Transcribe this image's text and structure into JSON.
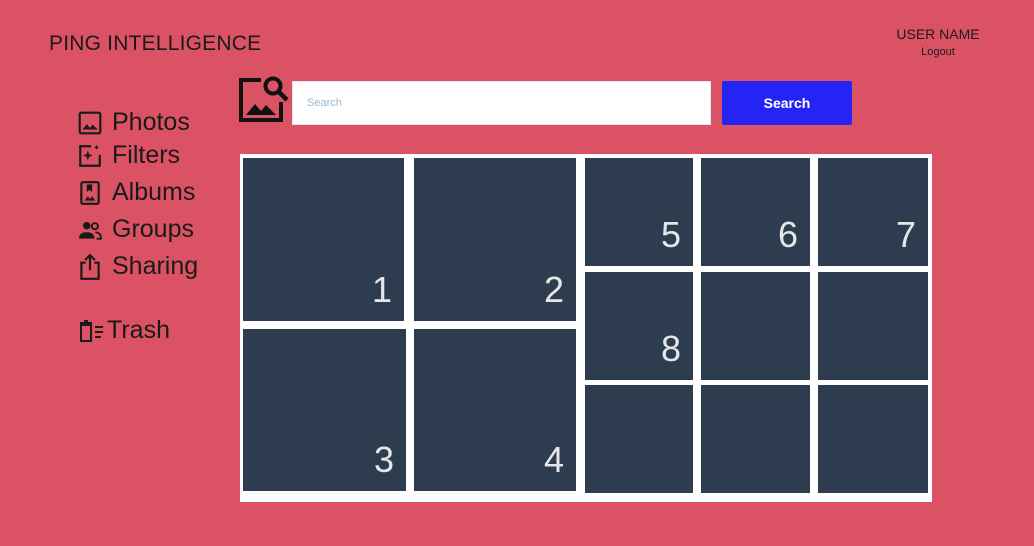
{
  "header": {
    "app_title": "PING INTELLIGENCE"
  },
  "user": {
    "name": "USER NAME",
    "logout_label": "Logout"
  },
  "sidebar": {
    "items": [
      {
        "label": "Photos",
        "icon": "image-icon"
      },
      {
        "label": "Filters",
        "icon": "filter-sparkle-icon"
      },
      {
        "label": "Albums",
        "icon": "album-icon"
      },
      {
        "label": "Groups",
        "icon": "groups-icon"
      },
      {
        "label": "Sharing",
        "icon": "share-icon"
      },
      {
        "label": "Trash",
        "icon": "trash-icon"
      }
    ]
  },
  "search": {
    "placeholder": "Search",
    "value": "",
    "button_label": "Search",
    "icon": "image-search-icon"
  },
  "gallery": {
    "tiles": [
      {
        "label": "1"
      },
      {
        "label": "2"
      },
      {
        "label": "5"
      },
      {
        "label": "6"
      },
      {
        "label": "7"
      },
      {
        "label": "8"
      },
      {
        "label": ""
      },
      {
        "label": ""
      },
      {
        "label": "3"
      },
      {
        "label": "4"
      },
      {
        "label": ""
      },
      {
        "label": ""
      },
      {
        "label": ""
      }
    ]
  },
  "colors": {
    "background": "#db5264",
    "accent": "#2424f5",
    "tile": "#2d3d4f"
  }
}
